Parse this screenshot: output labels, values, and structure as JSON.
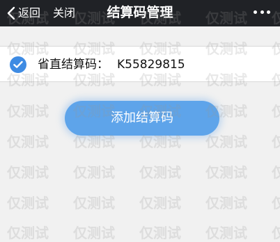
{
  "nav": {
    "back_label": "返回",
    "close_label": "关闭",
    "title": "结算码管理",
    "more_icon": "more-dots-icon"
  },
  "settlement_row": {
    "checked": true,
    "label": "省直结算码：",
    "code": "K55829815"
  },
  "add_button": {
    "label": "添加结算码"
  },
  "watermark": {
    "text": "仅测试"
  },
  "colors": {
    "nav_bg": "#202226",
    "page_bg": "#f1f1f1",
    "accent": "#3e8be3",
    "button": "#5ea4ea"
  }
}
